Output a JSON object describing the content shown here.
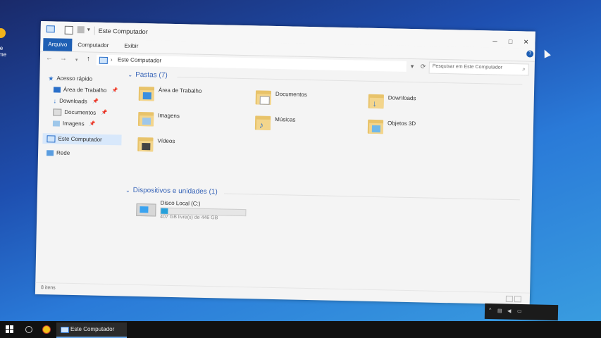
{
  "window": {
    "title": "Este Computador",
    "tabs": [
      "Arquivo",
      "Computador",
      "Exibir"
    ],
    "controls": {
      "minimize": "─",
      "maximize": "□",
      "close": "✕",
      "help": "?"
    }
  },
  "address": {
    "path": "Este Computador",
    "separator": "›",
    "search_placeholder": "Pesquisar em Este Computador",
    "nav": {
      "back": "←",
      "forward": "→",
      "dropdown": "▾",
      "up": "↑",
      "refresh": "⟳"
    }
  },
  "nav_pane": {
    "quick_access": "Acesso rápido",
    "quick_items": [
      "Área de Trabalho",
      "Downloads",
      "Documentos",
      "Imagens"
    ],
    "this_pc": "Este Computador",
    "network": "Rede"
  },
  "content": {
    "folders_header": "Pastas (7)",
    "folders": [
      {
        "label": "Área de Trabalho",
        "icon": "desktop-folder-icon"
      },
      {
        "label": "Documentos",
        "icon": "documents-folder-icon"
      },
      {
        "label": "Downloads",
        "icon": "downloads-folder-icon"
      },
      {
        "label": "Imagens",
        "icon": "pictures-folder-icon"
      },
      {
        "label": "Músicas",
        "icon": "music-folder-icon"
      },
      {
        "label": "Objetos 3D",
        "icon": "objects-3d-folder-icon"
      },
      {
        "label": "Vídeos",
        "icon": "videos-folder-icon"
      }
    ],
    "devices_header": "Dispositivos e unidades (1)",
    "disk": {
      "label": "Disco Local (C:)",
      "free_text": "407 GB livre(s) de 446 GB",
      "used_fraction": 0.087
    }
  },
  "status": {
    "items": "8 itens"
  },
  "taskbar": {
    "app_label": "Este Computador"
  },
  "colors": {
    "accent": "#1e5fb4",
    "folder": "#f3d58c",
    "section": "#3a66b8",
    "disk_bar": "#26a0da"
  }
}
